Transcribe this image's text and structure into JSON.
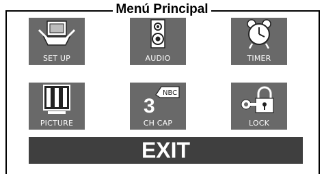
{
  "menu": {
    "title": "Menú Principal",
    "items": [
      {
        "label": "SET UP",
        "icon": "tv-setup-icon"
      },
      {
        "label": "AUDIO",
        "icon": "speaker-icon"
      },
      {
        "label": "TIMER",
        "icon": "alarm-clock-icon"
      },
      {
        "label": "PICTURE",
        "icon": "picture-bars-icon"
      },
      {
        "label": "CH CAP",
        "icon": "channel-caption-icon"
      },
      {
        "label": "LOCK",
        "icon": "padlock-key-icon"
      }
    ],
    "exit_label": "EXIT"
  },
  "colors": {
    "tile": "#696969",
    "exit_bar": "#3f3f3f",
    "text_light": "#ffffff",
    "frame": "#000000"
  }
}
